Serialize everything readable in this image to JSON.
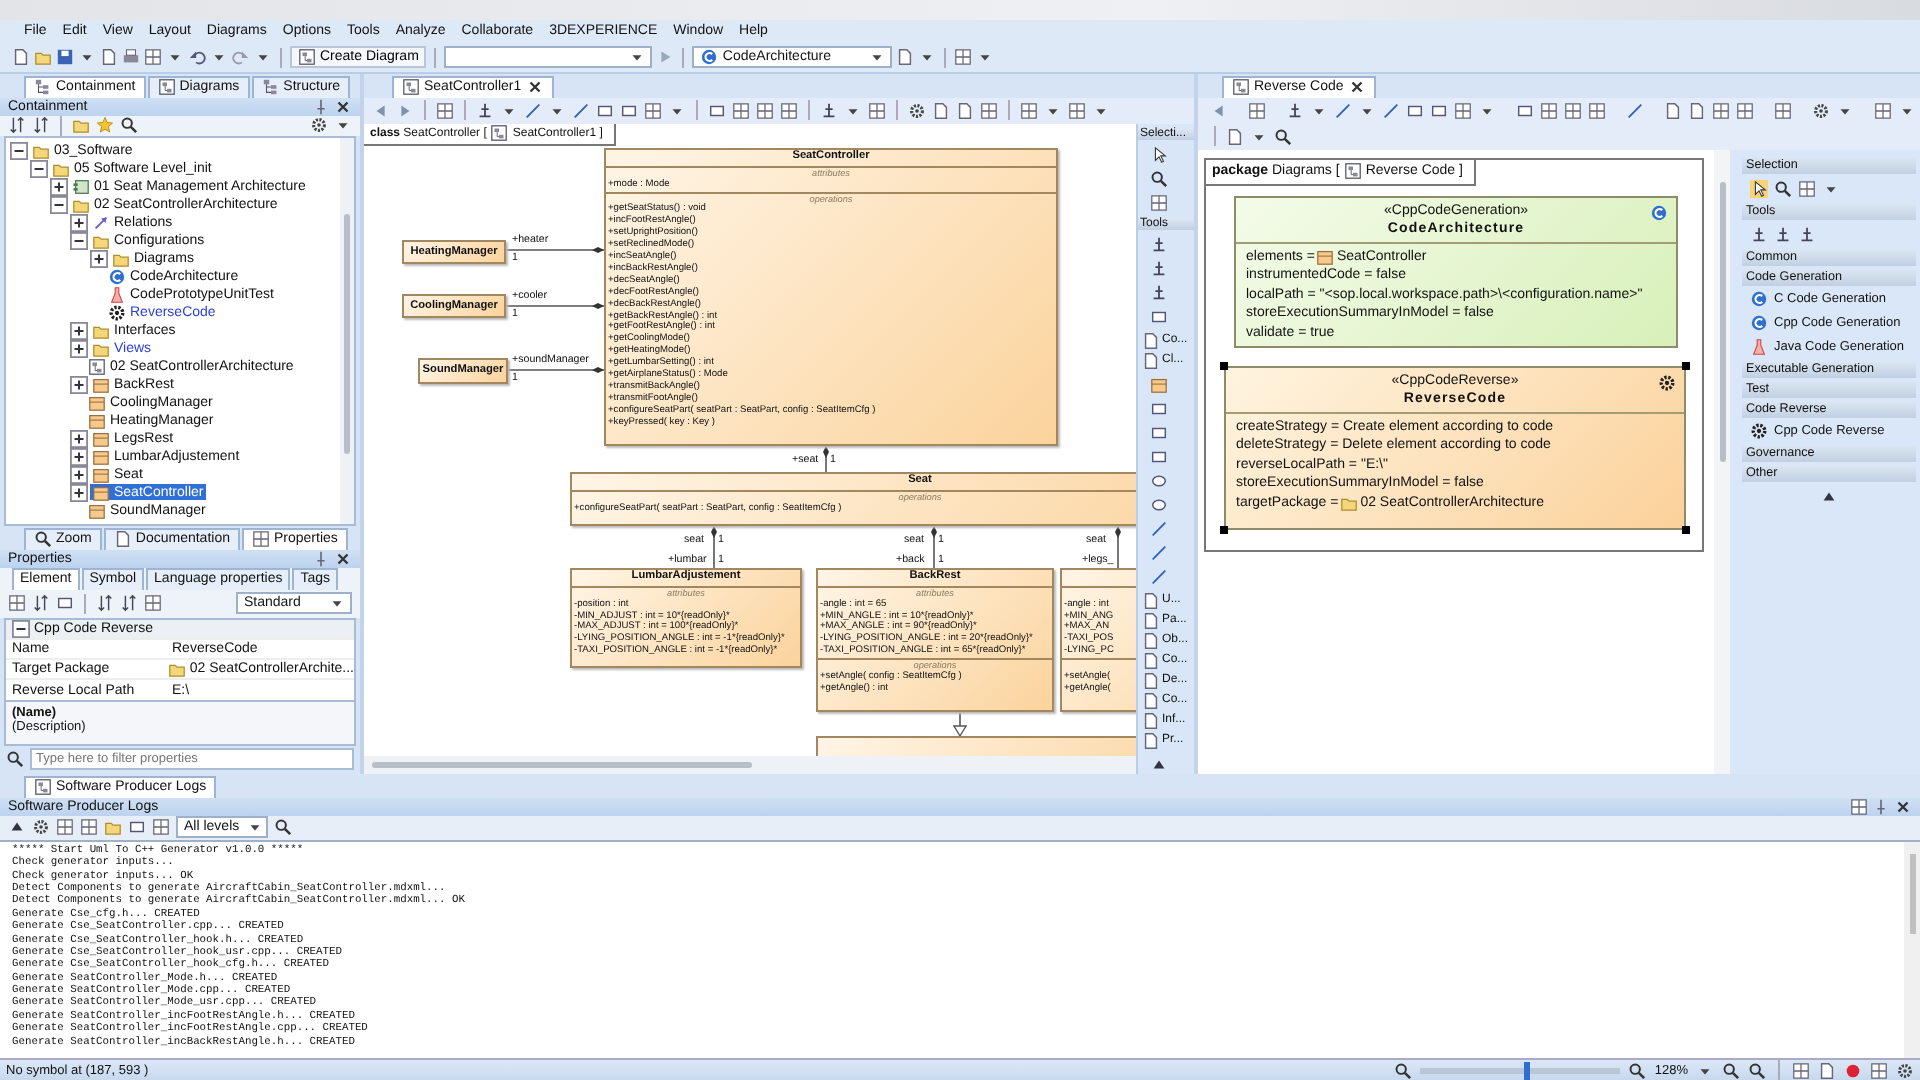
{
  "menu": [
    "File",
    "Edit",
    "View",
    "Layout",
    "Diagrams",
    "Options",
    "Tools",
    "Analyze",
    "Collaborate",
    "3DEXPERIENCE",
    "Window",
    "Help"
  ],
  "toolbar": {
    "create_diagram": "Create Diagram",
    "configuration": "CodeArchitecture"
  },
  "left_tabs": [
    {
      "label": "Containment",
      "kind": "tree",
      "selected": true
    },
    {
      "label": "Diagrams",
      "kind": "diagram",
      "selected": false
    },
    {
      "label": "Structure",
      "kind": "tree",
      "selected": false
    }
  ],
  "containment": {
    "title": "Containment",
    "tree": [
      {
        "label": "03_Software",
        "kind": "folder",
        "expanded": true,
        "selected": false,
        "children": [
          {
            "label": "05 Software Level_init",
            "kind": "folder",
            "expanded": true,
            "selected": false,
            "children": [
              {
                "label": "01 Seat Management Architecture",
                "kind": "component",
                "expanded": false,
                "selected": false
              },
              {
                "label": "02 SeatControllerArchitecture",
                "kind": "folder",
                "expanded": true,
                "selected": false,
                "children": [
                  {
                    "label": "Relations",
                    "kind": "relations",
                    "expanded": false,
                    "selected": false
                  },
                  {
                    "label": "Configurations",
                    "kind": "folder",
                    "expanded": true,
                    "selected": false,
                    "children": [
                      {
                        "label": "Diagrams",
                        "kind": "folder",
                        "expanded": false,
                        "selected": false
                      },
                      {
                        "label": "CodeArchitecture",
                        "kind": "generator",
                        "selected": false
                      },
                      {
                        "label": "CodePrototypeUnitTest",
                        "kind": "test",
                        "selected": false
                      },
                      {
                        "label": "ReverseCode",
                        "kind": "reverse",
                        "selected": false,
                        "color": "#2b3fd6"
                      }
                    ]
                  },
                  {
                    "label": "Interfaces",
                    "kind": "folder",
                    "expanded": false,
                    "selected": false
                  },
                  {
                    "label": "Views",
                    "kind": "folder",
                    "expanded": false,
                    "selected": false,
                    "color": "#2b3fd6"
                  },
                  {
                    "label": "02 SeatControllerArchitecture",
                    "kind": "diagram",
                    "selected": false
                  },
                  {
                    "label": "BackRest",
                    "kind": "class",
                    "expanded": false,
                    "selected": false
                  },
                  {
                    "label": "CoolingManager",
                    "kind": "class",
                    "selected": false
                  },
                  {
                    "label": "HeatingManager",
                    "kind": "class",
                    "selected": false
                  },
                  {
                    "label": "LegsRest",
                    "kind": "class",
                    "expanded": false,
                    "selected": false
                  },
                  {
                    "label": "LumbarAdjustement",
                    "kind": "class",
                    "expanded": false,
                    "selected": false
                  },
                  {
                    "label": "Seat",
                    "kind": "class",
                    "expanded": false,
                    "selected": false
                  },
                  {
                    "label": "SeatController",
                    "kind": "class",
                    "expanded": false,
                    "selected": true
                  },
                  {
                    "label": "SoundManager",
                    "kind": "class",
                    "selected": false
                  }
                ]
              }
            ]
          }
        ]
      }
    ]
  },
  "bottom_tabs": [
    {
      "label": "Zoom",
      "kind": "zoom",
      "selected": false
    },
    {
      "label": "Documentation",
      "kind": "doc",
      "selected": false
    },
    {
      "label": "Properties",
      "kind": "grid",
      "selected": true
    }
  ],
  "properties": {
    "title": "Properties",
    "tabs": [
      {
        "label": "Element",
        "selected": true
      },
      {
        "label": "Symbol",
        "selected": false
      },
      {
        "label": "Language properties",
        "selected": false
      },
      {
        "label": "Tags",
        "selected": false
      }
    ],
    "mode": "Standard",
    "group": "Cpp Code Reverse",
    "rows": [
      {
        "name": "Name",
        "value": "ReverseCode"
      },
      {
        "name": "Target Package",
        "value": "02 SeatControllerArchite...",
        "kind": "folder"
      },
      {
        "name": "Reverse Local Path",
        "value": "E:\\"
      }
    ],
    "description_title": "(Name)",
    "description": "(Description)",
    "filter_placeholder": "Type here to filter properties"
  },
  "center": {
    "tab": "SeatController1",
    "frame": {
      "keyword": "class",
      "name": "SeatController [",
      "diagram": "SeatController1 ]"
    },
    "classes": [
      {
        "name": "SeatController",
        "sections": [
          {
            "label": "attributes",
            "items": [
              "+mode : Mode"
            ]
          },
          {
            "label": "operations",
            "items": [
              "+getSeatStatus() : void",
              "+incFootRestAngle()",
              "+setUprightPosition()",
              "+setReclinedMode()",
              "+incSeatAngle()",
              "+incBackRestAngle()",
              "+decSeatAngle()",
              "+decFootRestAngle()",
              "+decBackRestAngle()",
              "+getBackRestAngle() : int",
              "+getFootRestAngle() : int",
              "+getCoolingMode()",
              "+getHeatingMode()",
              "+getLumbarSetting() : int",
              "+getAirplaneStatus() : Mode",
              "+transmitBackAngle()",
              "+transmitFootAngle()",
              "+configureSeatPart( seatPart : SeatPart, config : SeatItemCfg )",
              "+keyPressed( key : Key )"
            ]
          }
        ]
      },
      {
        "name": "HeatingManager"
      },
      {
        "name": "CoolingManager"
      },
      {
        "name": "SoundManager"
      },
      {
        "name": "Seat",
        "sections": [
          {
            "label": "operations",
            "items": [
              "+configureSeatPart( seatPart : SeatPart, config : SeatItemCfg )"
            ]
          }
        ]
      },
      {
        "name": "LumbarAdjustement",
        "sections": [
          {
            "label": "attributes",
            "items": [
              "-position : int",
              "-MIN_ADJUST : int = 10*{readOnly}*",
              "-MAX_ADJUST : int = 100*{readOnly}*",
              "-LYING_POSITION_ANGLE : int = -1*{readOnly}*",
              "-TAXI_POSITION_ANGLE : int = -1*{readOnly}*"
            ]
          }
        ]
      },
      {
        "name": "BackRest",
        "sections": [
          {
            "label": "attributes",
            "items": [
              "-angle : int = 65",
              "+MIN_ANGLE : int = 10*{readOnly}*",
              "+MAX_ANGLE : int = 90*{readOnly}*",
              "-LYING_POSITION_ANGLE : int = 20*{readOnly}*",
              "-TAXI_POSITION_ANGLE : int = 65*{readOnly}*"
            ]
          },
          {
            "label": "operations",
            "items": [
              "+setAngle( config : SeatItemCfg )",
              "+getAngle() : int"
            ]
          }
        ]
      },
      {
        "sections": [
          {
            "items": [
              "-angle : int",
              "+MIN_ANG",
              "+MAX_AN",
              "-TAXI_POS",
              "-LYING_PC"
            ]
          },
          {
            "items": [
              "+setAngle(",
              "+getAngle("
            ]
          }
        ]
      }
    ],
    "connectors": [
      {
        "kind": "association",
        "labels": [
          "+heater",
          "1"
        ]
      },
      {
        "kind": "association",
        "labels": [
          "+cooler",
          "1"
        ]
      },
      {
        "kind": "association",
        "labels": [
          "+soundManager",
          "1"
        ]
      },
      {
        "kind": "association",
        "labels": [
          "+seat",
          "1"
        ]
      },
      {
        "kind": "association",
        "labels": [
          "seat",
          "1",
          "+lumbar",
          "1"
        ]
      },
      {
        "kind": "association",
        "labels": [
          "seat",
          "1",
          "+back",
          "1"
        ]
      },
      {
        "kind": "association",
        "labels": [
          "seat",
          "+legs_"
        ]
      },
      {
        "kind": "generalization"
      }
    ],
    "palette": [
      {
        "kind": "header",
        "label": "Selecti..."
      },
      {
        "kind": "header",
        "label": "Tools"
      },
      {
        "kind": "tool",
        "label": "Co..."
      },
      {
        "kind": "tool",
        "label": "Cl..."
      },
      {
        "kind": "tool",
        "label": "U..."
      },
      {
        "kind": "tool",
        "label": "Pa..."
      },
      {
        "kind": "tool",
        "label": "Ob..."
      },
      {
        "kind": "tool",
        "label": "Co..."
      },
      {
        "kind": "tool",
        "label": "De..."
      },
      {
        "kind": "tool",
        "label": "Co..."
      },
      {
        "kind": "tool",
        "label": "Inf..."
      },
      {
        "kind": "tool",
        "label": "Pr..."
      }
    ]
  },
  "right": {
    "tab": "Reverse Code",
    "frame": {
      "keyword": "package",
      "name": "Diagrams [",
      "diagram": "Reverse Code ]"
    },
    "elements": [
      {
        "stereotype": "«CppCodeGeneration»",
        "name": "CodeArchitecture",
        "kind": "generation",
        "selected": false,
        "properties": [
          {
            "label": "elements =",
            "value": "SeatController",
            "kind": "class"
          },
          {
            "label": "instrumentedCode = false"
          },
          {
            "label": "localPath = \"<sop.local.workspace.path>\\<configuration.name>\""
          },
          {
            "label": "storeExecutionSummaryInModel = false"
          },
          {
            "label": "validate = true"
          }
        ]
      },
      {
        "stereotype": "«CppCodeReverse»",
        "name": "ReverseCode",
        "kind": "reverse",
        "selected": true,
        "properties": [
          {
            "label": "createStrategy = Create element according to code"
          },
          {
            "label": "deleteStrategy = Delete element according to code"
          },
          {
            "label": "reverseLocalPath = \"E:\\\""
          },
          {
            "label": "storeExecutionSummaryInModel = false"
          },
          {
            "label": "targetPackage =",
            "value": "02 SeatControllerArchitecture",
            "kind": "folder"
          }
        ]
      }
    ],
    "palette": [
      {
        "title": "Selection",
        "kind": "selection"
      },
      {
        "title": "Tools",
        "kind": "tools"
      },
      {
        "title": "Common"
      },
      {
        "title": "Code Generation",
        "items": [
          {
            "label": "C Code Generation",
            "kind": "generator"
          },
          {
            "label": "Cpp Code Generation",
            "kind": "generator"
          },
          {
            "label": "Java Code Generation",
            "kind": "test"
          }
        ]
      },
      {
        "title": "Executable Generation"
      },
      {
        "title": "Test"
      },
      {
        "title": "Code Reverse",
        "items": [
          {
            "label": "Cpp Code Reverse",
            "kind": "reverse"
          }
        ]
      },
      {
        "title": "Governance"
      },
      {
        "title": "Other"
      }
    ]
  },
  "logs": {
    "tab": "Software Producer Logs",
    "title": "Software Producer Logs",
    "level": "All levels",
    "lines": [
      "***** Start Uml To C++ Generator v1.0.0 *****",
      "Check generator inputs...",
      "Check generator inputs... OK",
      "Detect Components to generate AircraftCabin_SeatController.mdxml...",
      "Detect Components to generate AircraftCabin_SeatController.mdxml... OK",
      "Generate Cse_cfg.h... CREATED",
      "Generate Cse_SeatController.cpp... CREATED",
      "Generate Cse_SeatController_hook.h... CREATED",
      "Generate Cse_SeatController_hook_usr.cpp... CREATED",
      "Generate Cse_SeatController_hook_cfg.h... CREATED",
      "Generate SeatController_Mode.h... CREATED",
      "Generate SeatController_Mode.cpp... CREATED",
      "Generate SeatController_Mode_usr.cpp... CREATED",
      "Generate SeatController_incFootRestAngle.h... CREATED",
      "Generate SeatController_incFootRestAngle.cpp... CREATED",
      "Generate SeatController_incBackRestAngle.h... CREATED"
    ]
  },
  "status_bar": {
    "message": "No symbol at (187, 593 )",
    "zoom": "128%",
    "zoom_slider": {
      "level": 0.53
    }
  }
}
